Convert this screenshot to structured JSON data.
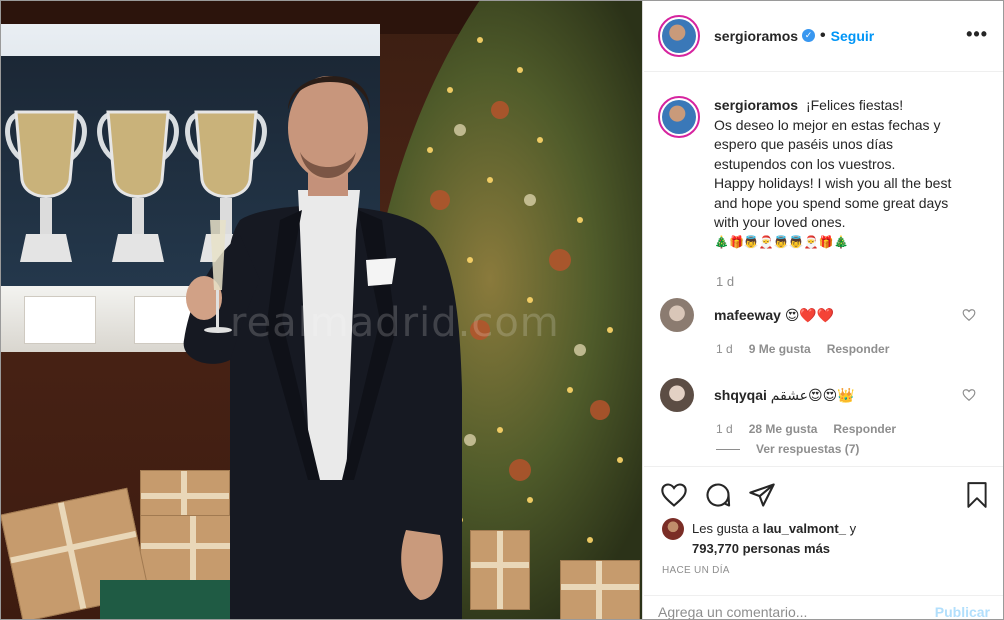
{
  "post": {
    "username": "sergioramos",
    "follow_label": "Seguir",
    "more_label": "•••"
  },
  "photo": {
    "watermark": "realmadrid.com"
  },
  "caption": {
    "username": "sergioramos",
    "lines": [
      "¡Felices fiestas!",
      "Os deseo lo mejor en estas fechas y",
      "espero que paséis unos días",
      "estupendos con los vuestros.",
      "Happy holidays! I wish you all the best",
      "and hope you spend some great days",
      "with your loved ones.",
      "🎄🎁👼🎅👼👼🎅🎁🎄"
    ],
    "time": "1 d"
  },
  "comments": [
    {
      "username": "mafeeway",
      "text": "😍❤️❤️",
      "time": "1 d",
      "likes": "9 Me gusta",
      "reply": "Responder"
    },
    {
      "username": "shqyqai",
      "text": "عشقم😍😍👑",
      "time": "1 d",
      "likes": "28 Me gusta",
      "reply": "Responder",
      "replies": "Ver respuestas (7)"
    }
  ],
  "likes": {
    "prefix": "Les gusta a",
    "user": "lau_valmont_",
    "connector": "y",
    "count": "793,770 personas más"
  },
  "posted": "HACE UN DÍA",
  "comment_input": {
    "placeholder": "Agrega un comentario...",
    "publish": "Publicar"
  },
  "colors": {
    "accent": "#0095f6",
    "verified": "#3897f0",
    "muted": "#8e8e8e",
    "like_red": "#ed4956"
  },
  "icons": [
    "heart-icon",
    "comment-icon",
    "share-icon",
    "bookmark-icon",
    "verified-icon",
    "more-icon"
  ]
}
